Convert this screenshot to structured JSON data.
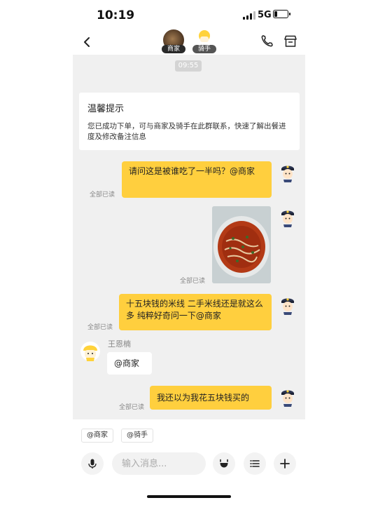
{
  "status": {
    "time": "10:19",
    "network": "5G",
    "battery_level": 0.25
  },
  "header": {
    "merchant_tag": "商家",
    "rider_tag": "骑手"
  },
  "chat": {
    "timestamp": "09:55",
    "tip": {
      "title": "温馨提示",
      "text": "您已成功下单，可与商家及骑手在此群联系，快速了解出餐进度及修改备注信息"
    },
    "messages": [
      {
        "text": "请问这是被谁吃了一半吗？@商家",
        "read": "全部已读"
      },
      {
        "type": "image",
        "read": "全部已读"
      },
      {
        "text": "十五块钱的米线 二手米线还是就这么多 纯粹好奇问一下@商家",
        "read": "全部已读"
      },
      {
        "sender": "王恩楠",
        "text": "@商家"
      },
      {
        "text": "我还以为我花五块钱买的",
        "read": "全部已读"
      }
    ]
  },
  "mentions": [
    "@商家",
    "@骑手"
  ],
  "input": {
    "placeholder": "输入消息..."
  },
  "colors": {
    "bubble": "#ffcf3e",
    "chat_bg": "#f0f0f0"
  }
}
